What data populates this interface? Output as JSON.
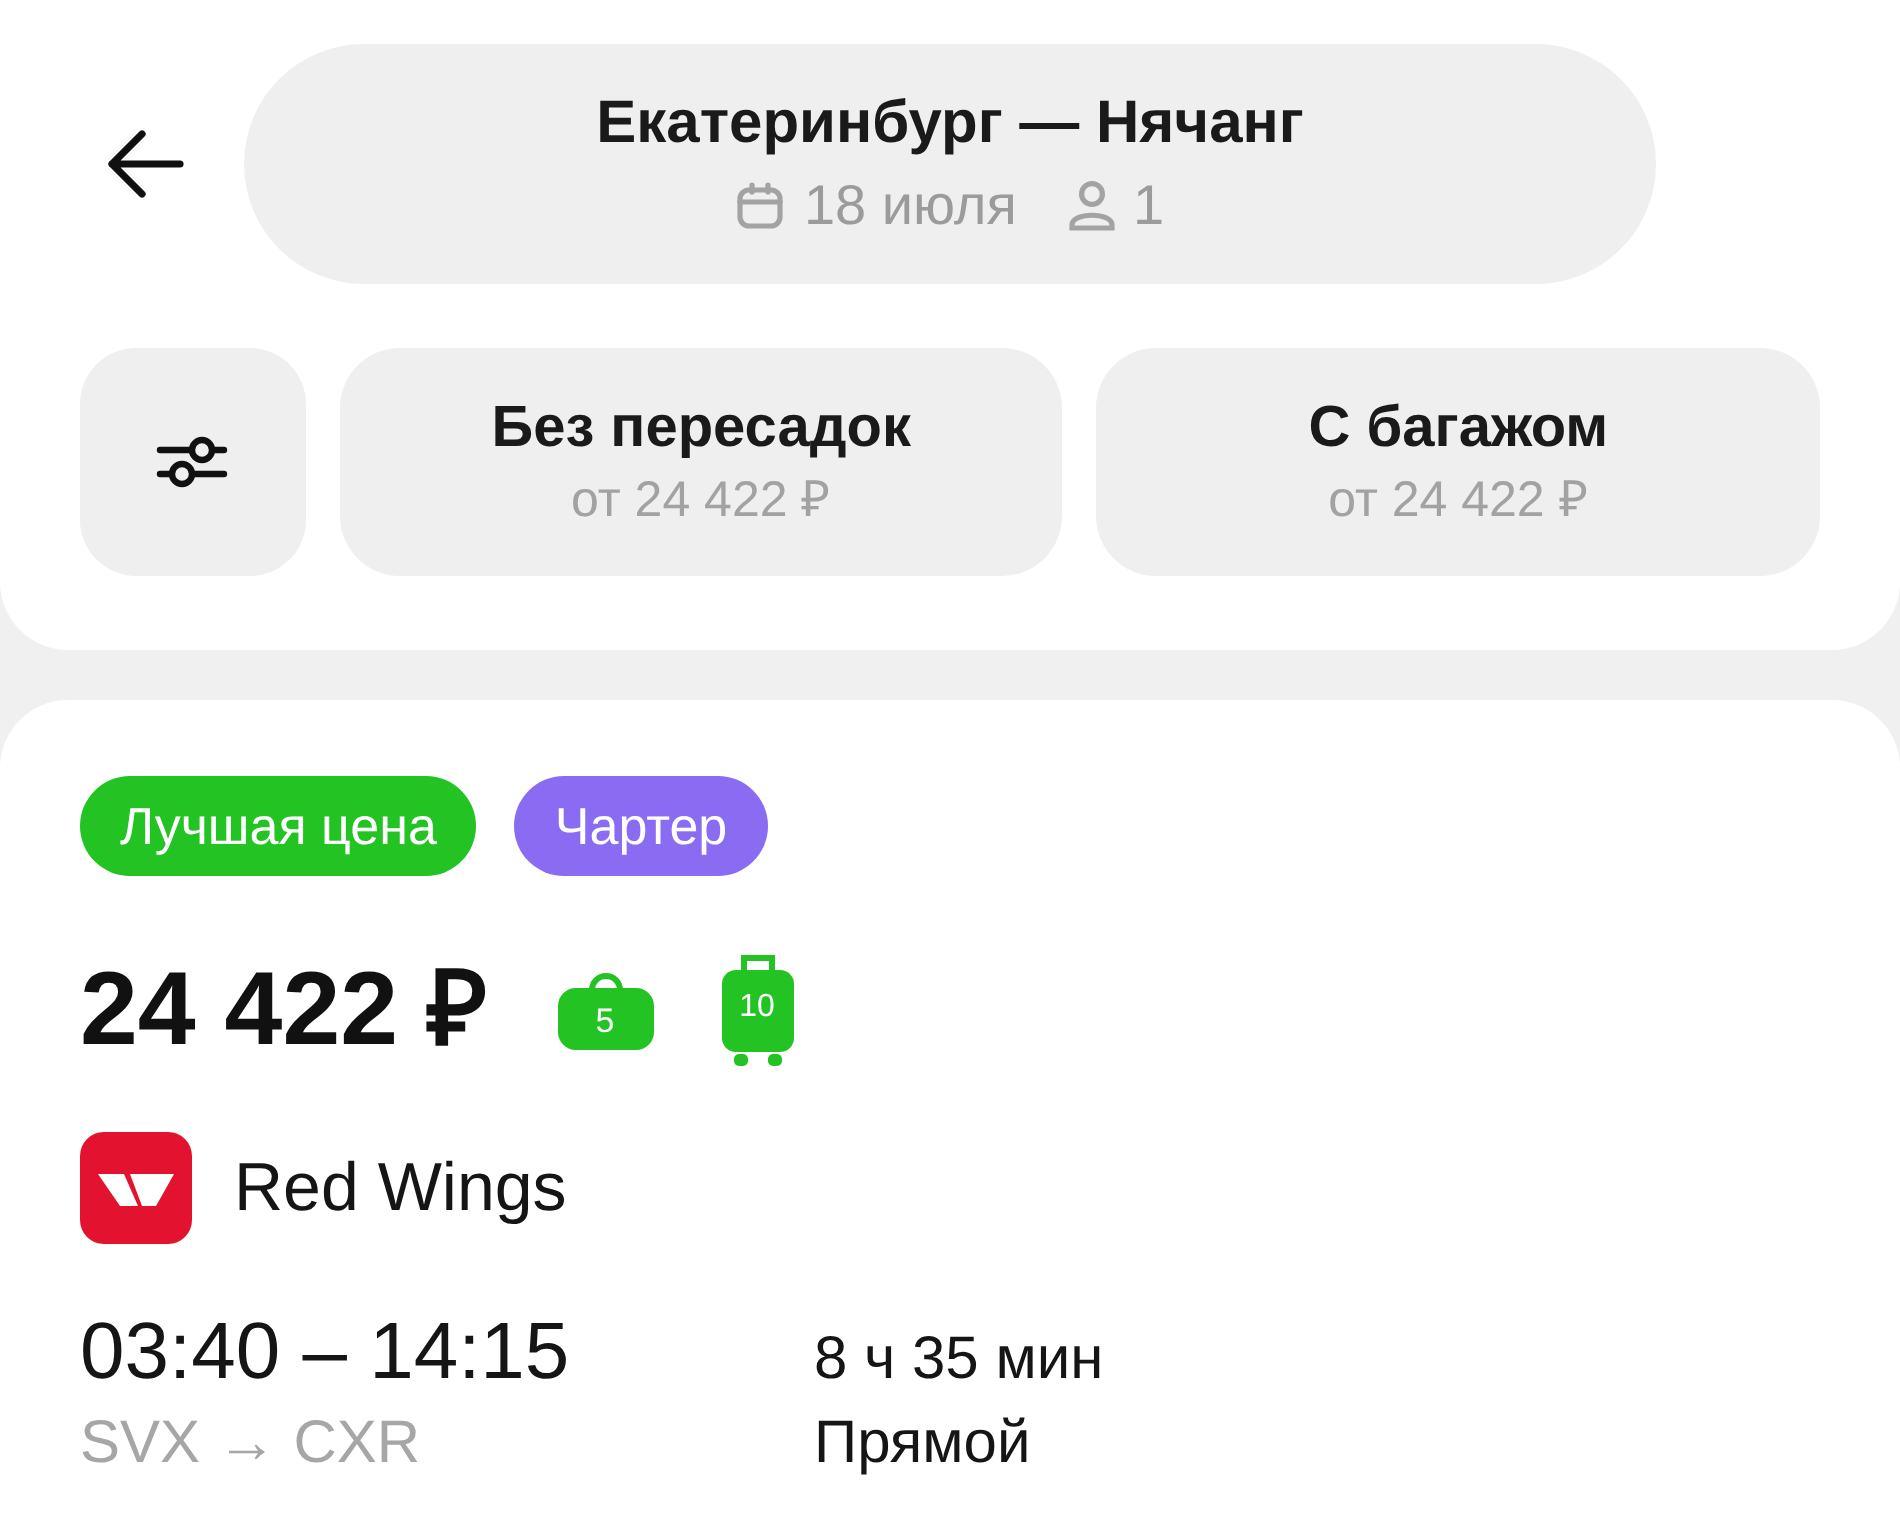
{
  "header": {
    "title": "Екатеринбург — Нячанг",
    "date": "18 июля",
    "passengers": "1"
  },
  "filters": [
    {
      "title": "Без пересадок",
      "price": "от 24 422 ₽",
      "selected": false
    },
    {
      "title": "С багажом",
      "price": "от 24 422 ₽",
      "selected": false
    }
  ],
  "ticket": {
    "tags": [
      {
        "label": "Лучшая цена",
        "color": "#22c322"
      },
      {
        "label": "Чартер",
        "color": "#8a6cf2"
      }
    ],
    "price": "24 422 ₽",
    "baggage": [
      {
        "kind": "handbag",
        "weight": "5"
      },
      {
        "kind": "suitcase",
        "weight": "10"
      }
    ],
    "airline": "Red Wings",
    "times": "03:40 – 14:15",
    "duration": "8 ч 35 мин",
    "route": "SVX → CXR",
    "stops": "Прямой"
  }
}
